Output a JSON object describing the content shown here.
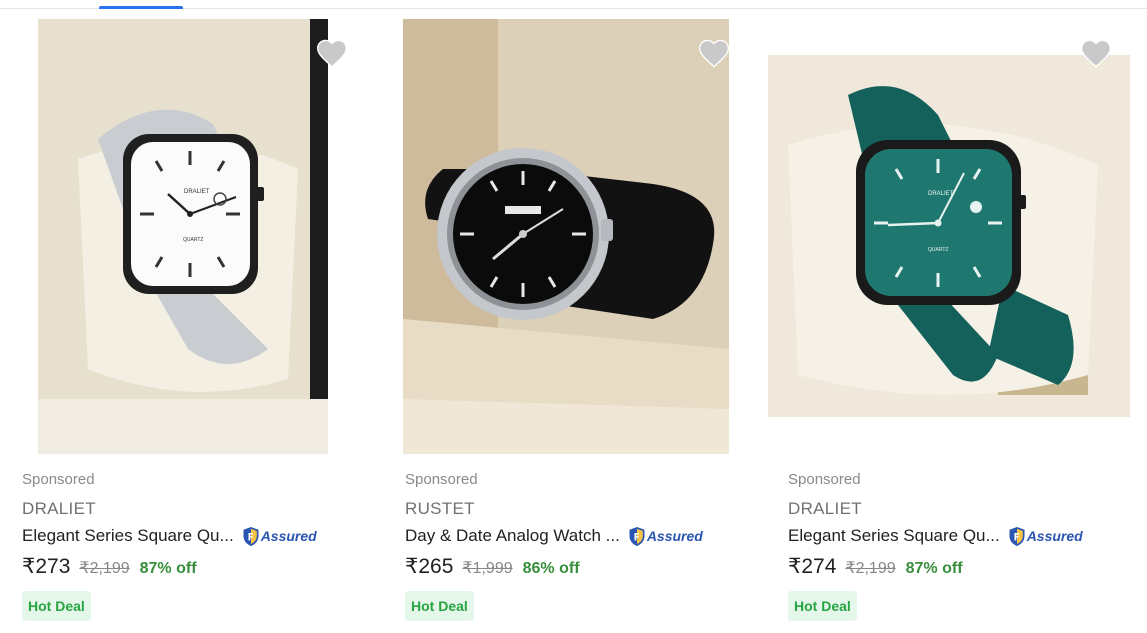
{
  "products": [
    {
      "sponsored": "Sponsored",
      "brand": "DRALIET",
      "title": "Elegant Series Square Qu...",
      "assured": "Assured",
      "price": "₹273",
      "mrp": "₹2,199",
      "discount": "87% off",
      "deal": "Hot Deal",
      "image": "square-watch-grey-strap",
      "dial_brand": "DRALIET",
      "dial_text": "QUARTZ"
    },
    {
      "sponsored": "Sponsored",
      "brand": "RUSTET",
      "title": "Day & Date Analog Watch ...",
      "assured": "Assured",
      "price": "₹265",
      "mrp": "₹1,999",
      "discount": "86% off",
      "deal": "Hot Deal",
      "image": "round-watch-black-strap"
    },
    {
      "sponsored": "Sponsored",
      "brand": "DRALIET",
      "title": "Elegant Series Square Qu...",
      "assured": "Assured",
      "price": "₹274",
      "mrp": "₹2,199",
      "discount": "87% off",
      "deal": "Hot Deal",
      "image": "square-watch-green-strap",
      "dial_brand": "DRALIET",
      "dial_text": "QUARTZ"
    }
  ],
  "icons": {
    "wishlist": "heart-icon",
    "assured": "shield-icon"
  },
  "colors": {
    "accent": "#2874f0",
    "discount": "#388e3c",
    "deal_bg": "#e5f7ea",
    "deal_text": "#26a541"
  }
}
